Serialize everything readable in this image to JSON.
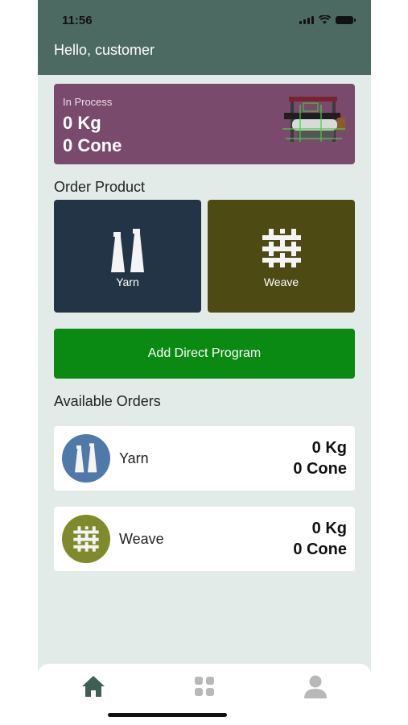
{
  "status": {
    "time": "11:56"
  },
  "header": {
    "greeting": "Hello, customer"
  },
  "process": {
    "label": "In Process",
    "kg": "0 Kg",
    "cone": "0 Cone",
    "color": "#7a4a6d"
  },
  "order_product": {
    "title": "Order Product",
    "tiles": [
      {
        "label": "Yarn",
        "icon": "yarn-cones-icon",
        "color": "#243447"
      },
      {
        "label": "Weave",
        "icon": "weave-icon",
        "color": "#4d4a14"
      }
    ]
  },
  "direct_program": {
    "label": "Add Direct Program",
    "color": "#0a8a12"
  },
  "available_orders": {
    "title": "Available Orders",
    "items": [
      {
        "name": "Yarn",
        "kg": "0 Kg",
        "cone": "0 Cone",
        "icon": "yarn-cones-icon",
        "color": "#4f79a8"
      },
      {
        "name": "Weave",
        "kg": "0 Kg",
        "cone": "0 Cone",
        "icon": "weave-icon",
        "color": "#7f8a2a"
      }
    ]
  },
  "tabbar": {
    "tabs": [
      "home-icon",
      "grid-icon",
      "profile-icon"
    ],
    "active": "home-icon"
  }
}
